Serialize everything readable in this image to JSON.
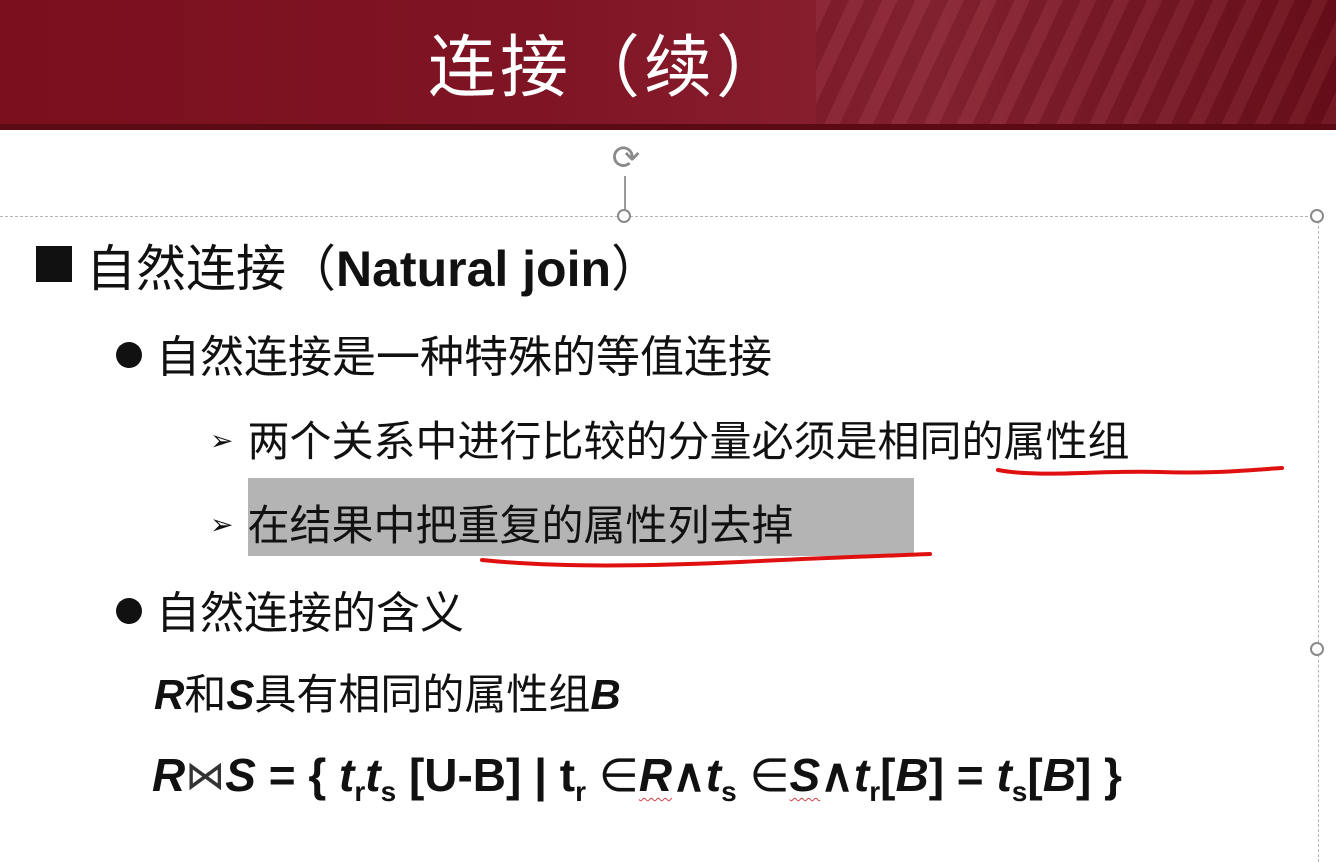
{
  "slide": {
    "title": "连接（续）",
    "heading_cn": "自然连接（",
    "heading_en": "Natural join",
    "heading_close": "）",
    "point1": "自然连接是一种特殊的等值连接",
    "sub1_prefix": "两个关系中进行比较的分量必须是",
    "sub1_emph": "相同的属性组",
    "sub2": "在结果中把重复的属性列去掉",
    "point2": "自然连接的含义",
    "def_r": "R",
    "def_and": "和",
    "def_s": "S",
    "def_mid": "具有相同的属性组",
    "def_b": "B",
    "formula": {
      "r": "R",
      "s": "S",
      "eq_open": " = {  ",
      "t": "t",
      "sub_r": "r",
      "sub_s": "s",
      "ub": " [U-B] | t",
      "in": " ∈",
      "and": "∧",
      "b_open": "[",
      "b": "B",
      "b_close": "]",
      "eq": " = ",
      "close": "] }"
    }
  },
  "colors": {
    "banner": "#7b0f1e",
    "highlight": "#b4b4b4",
    "annotation": "#e01010"
  },
  "icons": {
    "rotate": "rotate-handle-icon",
    "bullet_square": "square-bullet-icon",
    "bullet_dot": "round-bullet-icon",
    "arrow": "arrow-bullet-icon"
  }
}
